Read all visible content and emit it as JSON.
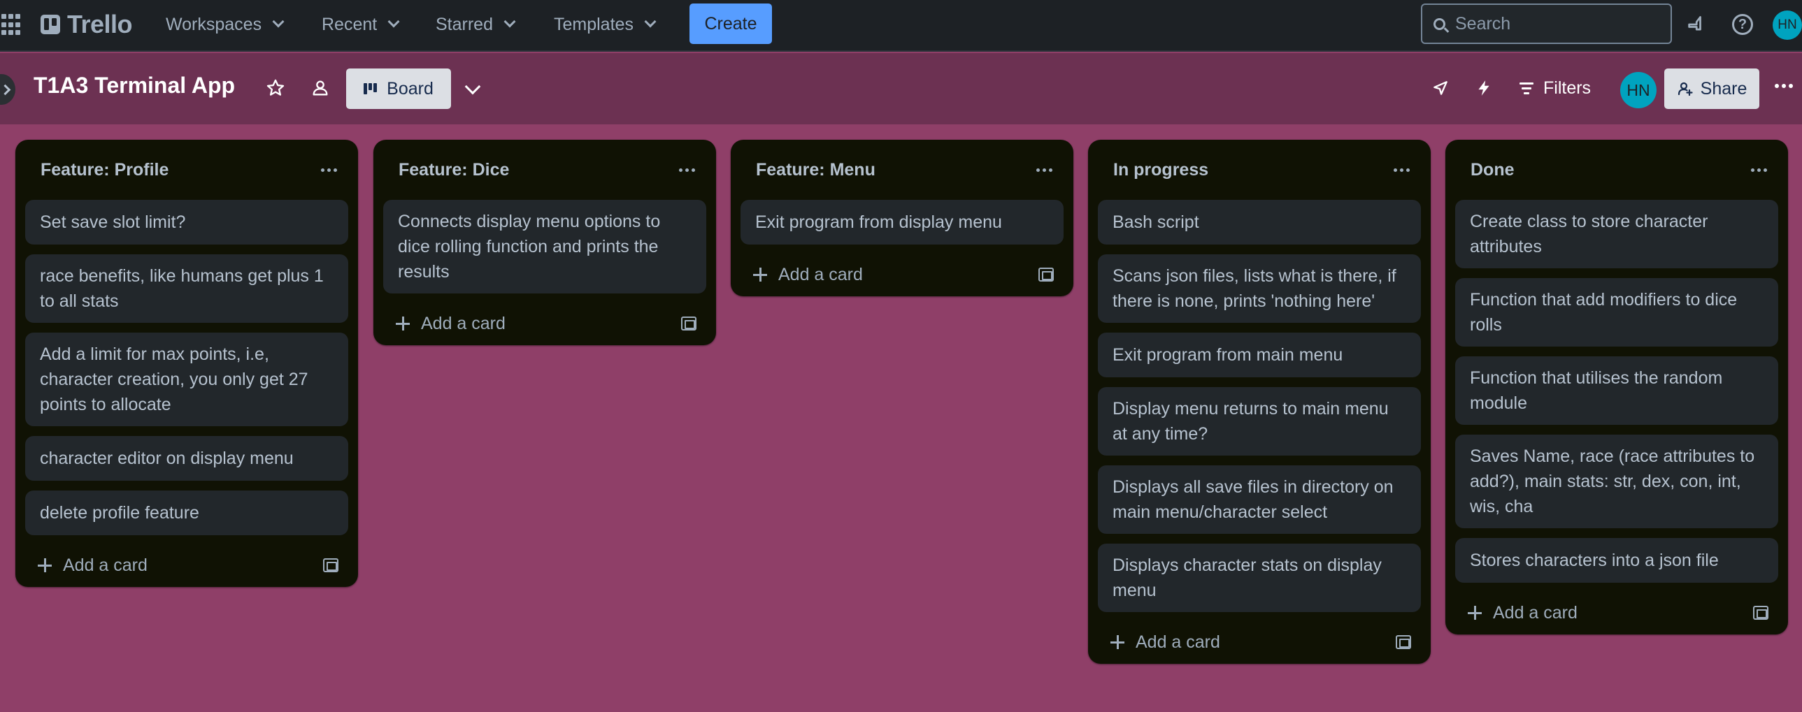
{
  "topnav": {
    "logo_text": "Trello",
    "menus": [
      {
        "label": "Workspaces"
      },
      {
        "label": "Recent"
      },
      {
        "label": "Starred"
      },
      {
        "label": "Templates"
      }
    ],
    "create_label": "Create",
    "search_placeholder": "Search",
    "avatar_initials": "HN"
  },
  "board": {
    "title": "T1A3 Terminal App",
    "view_label": "Board",
    "filters_label": "Filters",
    "share_label": "Share",
    "member_initials": "HN"
  },
  "lists": [
    {
      "title": "Feature: Profile",
      "cards": [
        "Set save slot limit?",
        "race benefits, like humans get plus 1 to all stats",
        "Add a limit for max points, i.e, character creation, you only get 27 points to allocate",
        "character editor on display menu",
        "delete profile feature"
      ],
      "add_label": "Add a card"
    },
    {
      "title": "Feature: Dice",
      "cards": [
        "Connects display menu options to dice rolling function and prints the results"
      ],
      "add_label": "Add a card"
    },
    {
      "title": "Feature: Menu",
      "cards": [
        "Exit program from display menu"
      ],
      "add_label": "Add a card"
    },
    {
      "title": "In progress",
      "cards": [
        "Bash script",
        "Scans json files, lists what is there, if there is none, prints 'nothing here'",
        "Exit program from main menu",
        "Display menu returns to main menu at any time?",
        "Displays all save files in directory on main menu/character select",
        "Displays character stats on display menu"
      ],
      "add_label": "Add a card"
    },
    {
      "title": "Done",
      "cards": [
        "Create class to store character attributes",
        "Function that add modifiers to dice rolls",
        "Function that utilises the random module",
        "Saves Name, race (race attributes to add?), main stats: str, dex, con, int, wis, cha",
        "Stores characters into a json file"
      ],
      "add_label": "Add a card"
    }
  ],
  "colors": {
    "board_background": "#8f3f68",
    "board_header": "#6c3152",
    "list_background": "#101204",
    "card_background": "#22272b",
    "create_button": "#579dff",
    "avatar": "#00a3bf"
  }
}
